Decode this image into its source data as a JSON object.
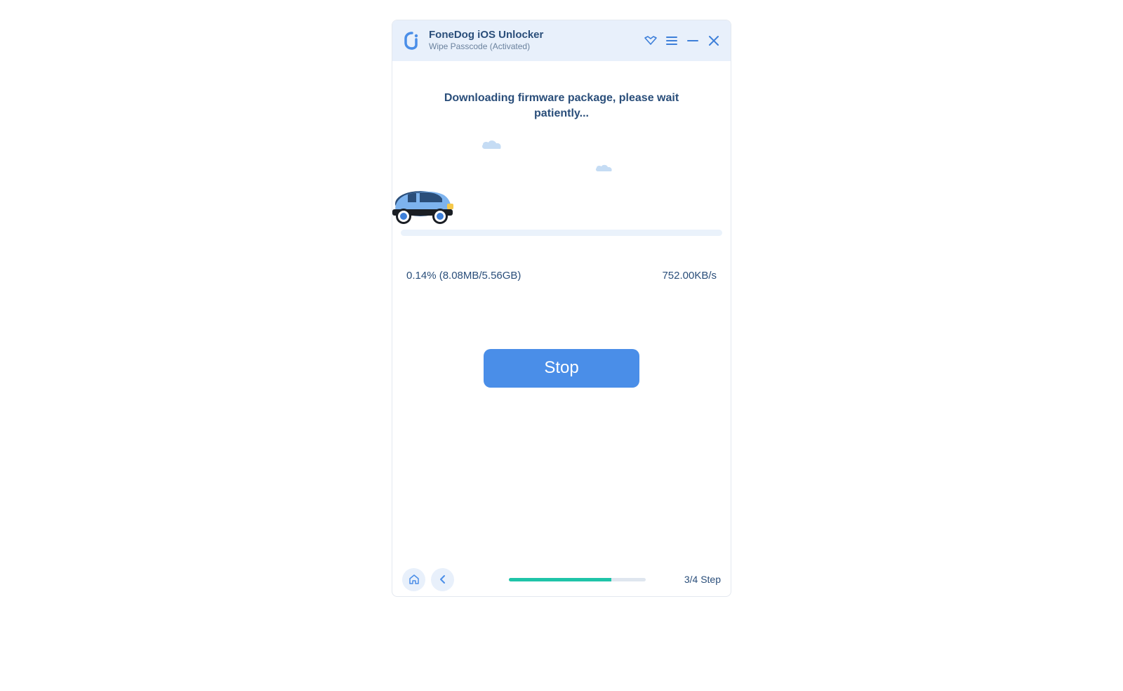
{
  "header": {
    "app_title": "FoneDog iOS Unlocker",
    "subtitle": "Wipe Passcode  (Activated)"
  },
  "main": {
    "status_heading": "Downloading firmware package, please wait patiently...",
    "progress_text": "0.14% (8.08MB/5.56GB)",
    "speed_text": "752.00KB/s",
    "stop_label": "Stop"
  },
  "footer": {
    "step_text": "3/4 Step",
    "step_progress_percent": 75
  },
  "colors": {
    "accent": "#4a8ee8",
    "titlebar_bg": "#e8f0fb",
    "text_primary": "#2a4e7a",
    "progress_fill": "#1fc4a8"
  }
}
